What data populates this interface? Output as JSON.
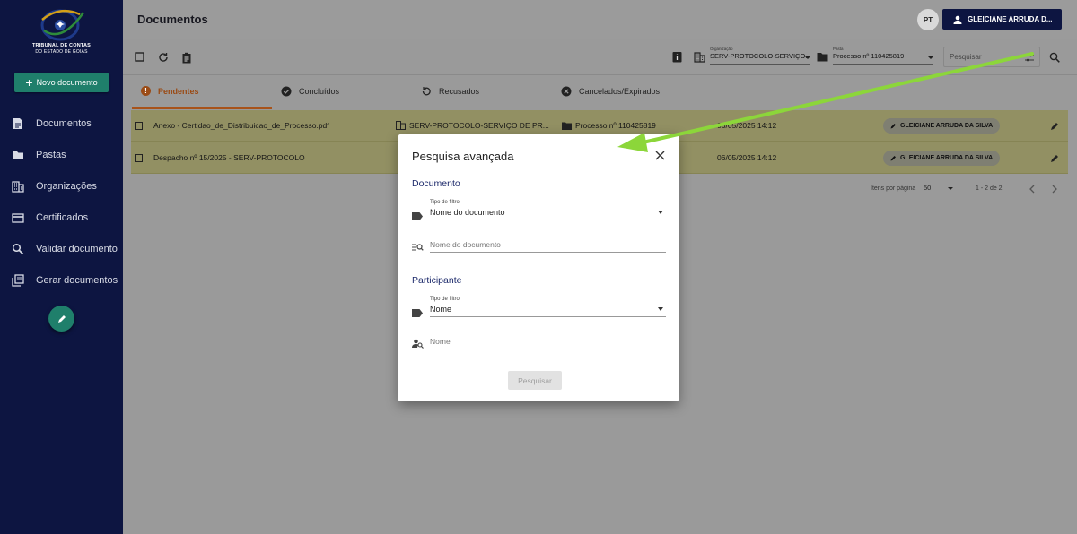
{
  "sidebar": {
    "logo_line1": "TRIBUNAL DE CONTAS",
    "logo_line2": "DO ESTADO DE GOIÁS",
    "new_document": "Novo documento",
    "items": [
      {
        "label": "Documentos",
        "icon": "document-icon"
      },
      {
        "label": "Pastas",
        "icon": "folder-icon"
      },
      {
        "label": "Organizações",
        "icon": "building-icon"
      },
      {
        "label": "Certificados",
        "icon": "card-icon"
      },
      {
        "label": "Validar documento",
        "icon": "search-check-icon"
      },
      {
        "label": "Gerar documentos",
        "icon": "library-icon"
      }
    ]
  },
  "header": {
    "title": "Documentos",
    "lang": "PT",
    "user": "GLEICIANE ARRUDA D..."
  },
  "toolbar": {
    "org_label": "Organização",
    "org_value": "SERV-PROTOCOLO-SERVIÇO...",
    "folder_label": "Pasta",
    "folder_value": "Processo nº 110425819",
    "search_placeholder": "Pesquisar"
  },
  "tabs": [
    {
      "label": "Pendentes"
    },
    {
      "label": "Concluídos"
    },
    {
      "label": "Recusados"
    },
    {
      "label": "Cancelados/Expirados"
    }
  ],
  "rows": [
    {
      "name": "Anexo - Certidao_de_Distribuicao_de_Processo.pdf",
      "org": "SERV-PROTOCOLO-SERVIÇO DE PR...",
      "folder": "Processo nº 110425819",
      "date": "06/05/2025 14:12",
      "signer": "GLEICIANE ARRUDA DA SILVA"
    },
    {
      "name": "Despacho nº 15/2025 - SERV-PROTOCOLO",
      "org": "",
      "folder": "",
      "date": "06/05/2025 14:12",
      "signer": "GLEICIANE ARRUDA DA SILVA"
    }
  ],
  "paginator": {
    "items_label": "Itens por página",
    "page_size": "50",
    "range": "1 - 2 de 2"
  },
  "modal": {
    "title": "Pesquisa avançada",
    "section_document": "Documento",
    "filter_label": "Tipo de filtro",
    "doc_filter_value": "Nome do documento",
    "doc_input_placeholder": "Nome do documento",
    "section_participant": "Participante",
    "part_filter_value": "Nome",
    "part_input_placeholder": "Nome",
    "submit": "Pesquisar"
  },
  "colors": {
    "sidebar": "#0d1541",
    "accent_green": "#1f7f6b",
    "active_tab": "#a8531a",
    "arrow": "#8cd63a"
  }
}
